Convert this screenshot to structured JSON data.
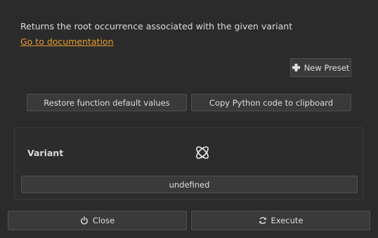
{
  "function": {
    "description": "Returns the root occurrence associated with the given variant",
    "doc_link_label": "Go to documentation"
  },
  "toolbar": {
    "new_preset_label": "New Preset",
    "new_preset_icon": "plus-icon",
    "restore_label": "Restore function default values",
    "copy_python_label": "Copy Python code to clipboard"
  },
  "params": {
    "variant": {
      "label": "Variant",
      "icon": "variant-icon",
      "value": "undefined"
    }
  },
  "footer": {
    "close_label": "Close",
    "close_icon": "power-icon",
    "execute_label": "Execute",
    "execute_icon": "refresh-icon"
  },
  "colors": {
    "background": "#2b2b2b",
    "button": "#3a3a3a",
    "link": "#e39b2d",
    "text": "#d8d8d8"
  }
}
